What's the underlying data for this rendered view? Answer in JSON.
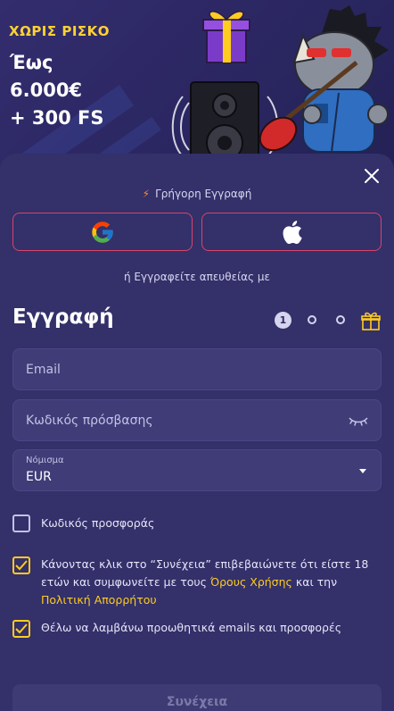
{
  "banner": {
    "promo_tag": "ΧΩΡΙΣ ΡΙΣΚΟ",
    "line1": "Έως",
    "line2": "6.000€",
    "line3": "+ 300 FS"
  },
  "sheet": {
    "quick_reg": "Γρήγορη Εγγραφή",
    "or_text": "ή Εγγραφείτε απευθείας με",
    "title": "Εγγραφή",
    "step_current": "1",
    "email_placeholder": "Email",
    "password_placeholder": "Κωδικός πρόσβασης",
    "currency_label": "Νόμισμα",
    "currency_value": "EUR",
    "promo_code_label": "Κωδικός προσφοράς",
    "terms_pre": "Κάνοντας κλικ στο “Συνέχεια” επιβεβαιώνετε ότι είστε 18 ετών και συμφωνείτε με τους ",
    "terms_link1": "Όρους Χρήσης",
    "terms_mid": " και την ",
    "terms_link2": "Πολιτική Απορρήτου",
    "emails_label": "Θέλω να λαμβάνω προωθητικά emails και προσφορές",
    "continue_label": "Συνέχεια"
  },
  "colors": {
    "accent": "#ffcc1f",
    "social_border": "#d8456a",
    "background": "#33306a"
  }
}
